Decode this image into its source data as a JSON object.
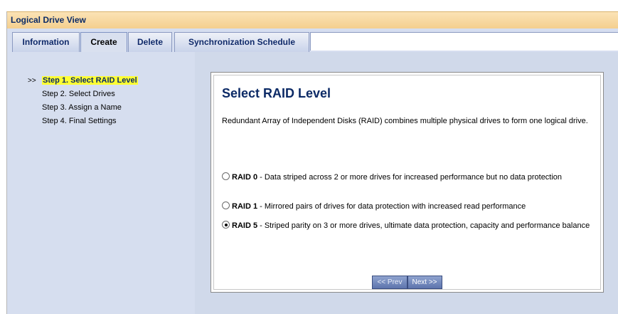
{
  "window": {
    "title": "Logical Drive View"
  },
  "tabs": [
    {
      "label": "Information",
      "active": false
    },
    {
      "label": "Create",
      "active": true
    },
    {
      "label": "Delete",
      "active": false
    },
    {
      "label": "Synchronization Schedule",
      "active": false
    }
  ],
  "steps": {
    "current_marker": ">>",
    "items": [
      {
        "label": "Step 1. Select RAID Level",
        "current": true
      },
      {
        "label": "Step 2. Select Drives",
        "current": false
      },
      {
        "label": "Step 3. Assign a Name",
        "current": false
      },
      {
        "label": "Step 4. Final Settings",
        "current": false
      }
    ]
  },
  "main": {
    "heading": "Select RAID Level",
    "description": "Redundant Array of Independent Disks (RAID) combines multiple physical drives to form one logical drive.",
    "options": [
      {
        "name": "RAID 0",
        "text": " - Data striped across 2 or more drives for increased performance but no data protection",
        "selected": false
      },
      {
        "name": "RAID 1",
        "text": " - Mirrored pairs of drives for data protection with increased read performance",
        "selected": false
      },
      {
        "name": "RAID 5",
        "text": " - Striped parity on 3 or more drives, ultimate data protection, capacity and performance balance",
        "selected": true
      }
    ],
    "prev_label": "<< Prev",
    "next_label": "Next >>"
  },
  "colors": {
    "title_bar": "#f4cf8e",
    "panel_bg": "#d6deef",
    "highlight": "#ffff33",
    "heading": "#0c2a66"
  }
}
